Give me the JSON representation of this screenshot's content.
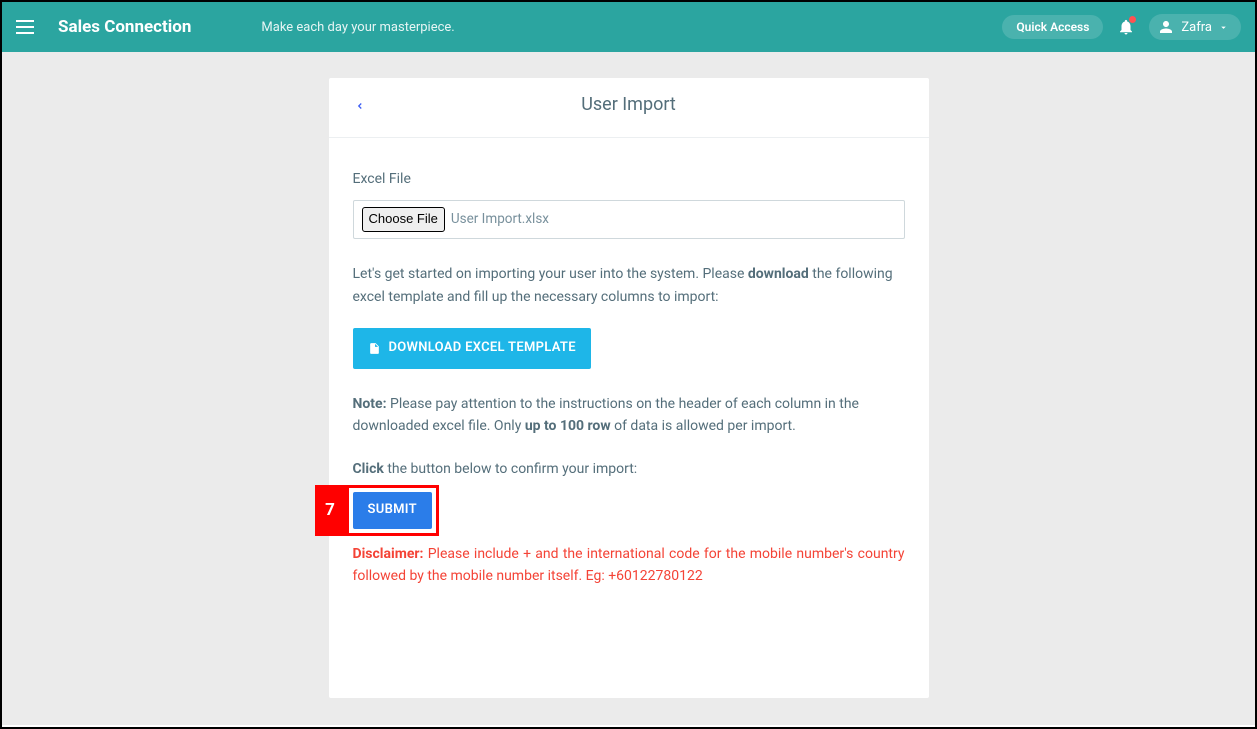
{
  "header": {
    "brand": "Sales Connection",
    "tagline": "Make each day your masterpiece.",
    "quick_access": "Quick Access",
    "user_name": "Zafra"
  },
  "card": {
    "title": "User Import",
    "excel_label": "Excel File",
    "choose_file": "Choose File",
    "file_name": "User Import.xlsx",
    "instr_prefix": "Let's get started on importing your user into the system. Please ",
    "instr_bold": "download",
    "instr_suffix": " the following excel template and fill up the necessary columns to import:",
    "download_btn": "DOWNLOAD EXCEL TEMPLATE",
    "note_label": "Note:",
    "note_text1": " Please pay attention to the instructions on the header of each column in the downloaded excel file. Only ",
    "note_bold": "up to 100 row",
    "note_text2": " of data is allowed per import.",
    "click_label": "Click",
    "click_text": " the button below to confirm your import:",
    "submit_btn": "SUBMIT",
    "callout_num": "7",
    "disclaimer_label": "Disclaimer:",
    "disclaimer_text": " Please include + and the international code for the mobile number's country followed by the mobile number itself. Eg: +60122780122"
  }
}
